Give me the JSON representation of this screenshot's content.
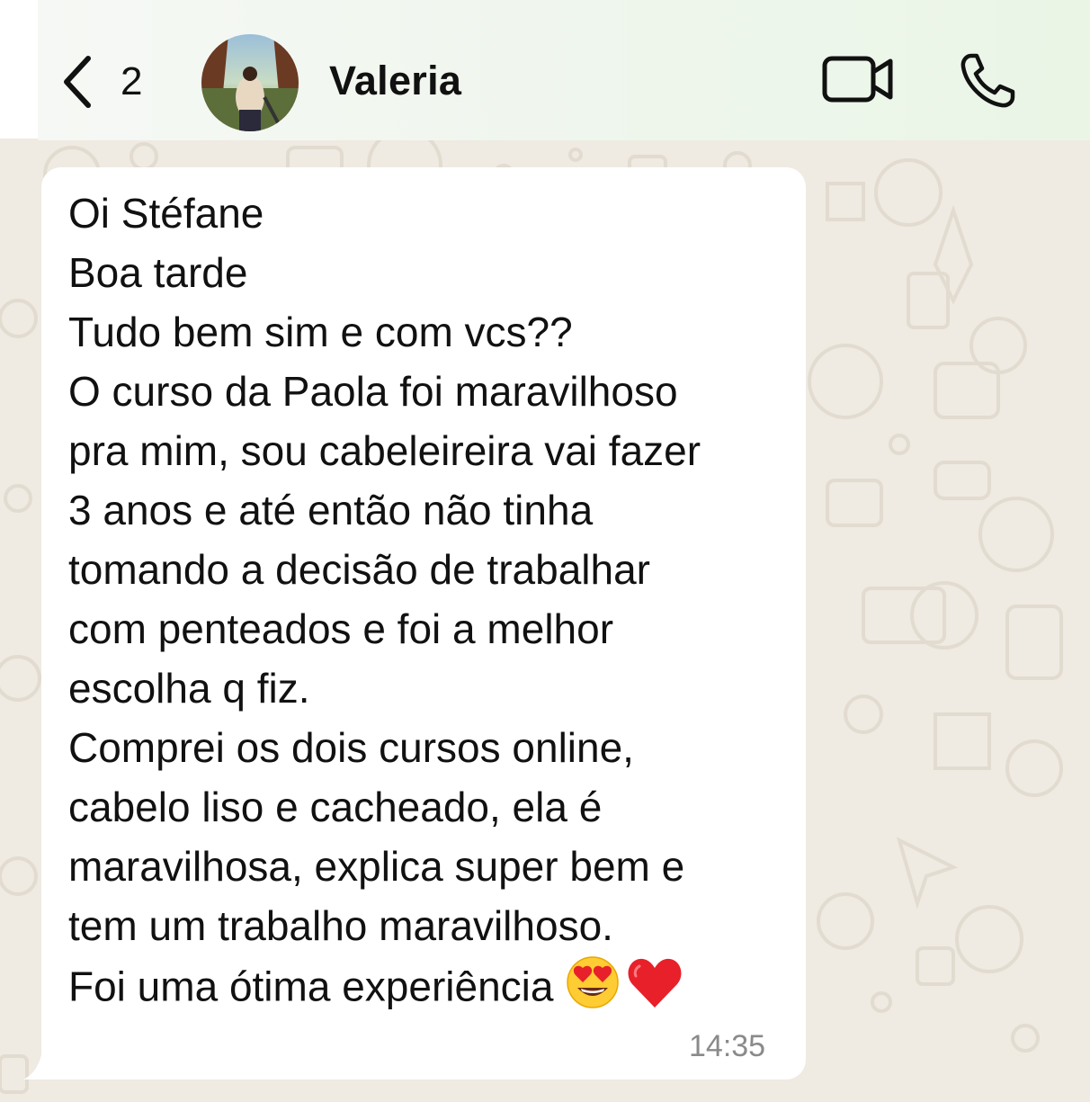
{
  "header": {
    "back_count": "2",
    "contact_name": "Valeria",
    "icons": [
      "chevron-left-icon",
      "video-call-icon",
      "phone-call-icon"
    ]
  },
  "message": {
    "lines": [
      "Oi Stéfane",
      "Boa tarde",
      "Tudo bem sim e com vcs??",
      "O curso da Paola foi maravilhoso",
      "pra mim, sou cabeleireira vai fazer",
      "3 anos e até então não tinha",
      "tomando a decisão de trabalhar",
      "com penteados e foi a melhor",
      "escolha q fiz.",
      "Comprei os dois cursos online,",
      "cabelo liso e cacheado, ela é",
      "maravilhosa, explica super bem e",
      "tem um trabalho maravilhoso.",
      "Foi uma ótima experiência"
    ],
    "emojis": [
      "heart-eyes-emoji",
      "red-heart-emoji"
    ],
    "time": "14:35"
  },
  "colors": {
    "header_bg": "#eef6ec",
    "chat_bg": "#efeae2",
    "bubble_bg": "#ffffff",
    "text": "#111111",
    "timestamp": "#8a8a8a"
  }
}
